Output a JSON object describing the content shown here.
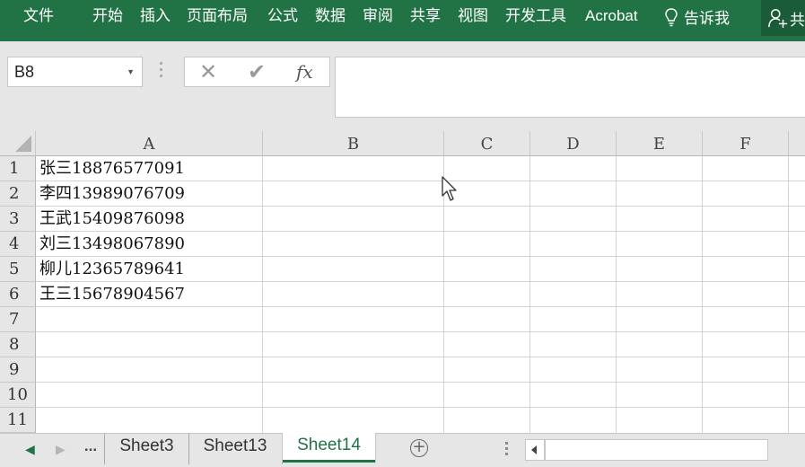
{
  "ribbon": {
    "tabs": [
      "文件",
      "开始",
      "插入",
      "页面布局",
      "公式",
      "数据",
      "审阅",
      "共享",
      "视图",
      "开发工具",
      "Acrobat"
    ],
    "tell_me": "告诉我",
    "share_partial": "共"
  },
  "formula_bar": {
    "name_box": "B8",
    "fx_label": "fx",
    "formula_value": ""
  },
  "grid": {
    "columns": [
      "A",
      "B",
      "C",
      "D",
      "E",
      "F"
    ],
    "rows": [
      "1",
      "2",
      "3",
      "4",
      "5",
      "6",
      "7",
      "8",
      "9",
      "10",
      "11"
    ],
    "cells_A": [
      "张三18876577091",
      "李四13989076709",
      "王武15409876098",
      "刘三13498067890",
      "柳儿12365789641",
      "王三15678904567"
    ]
  },
  "sheets": {
    "ellipsis": "...",
    "tabs": [
      "Sheet3",
      "Sheet13",
      "Sheet14"
    ],
    "active": "Sheet14",
    "add_label": "+"
  },
  "colors": {
    "accent": "#217346",
    "share_bg": "#1a5c38",
    "chrome": "#e6e6e6"
  }
}
